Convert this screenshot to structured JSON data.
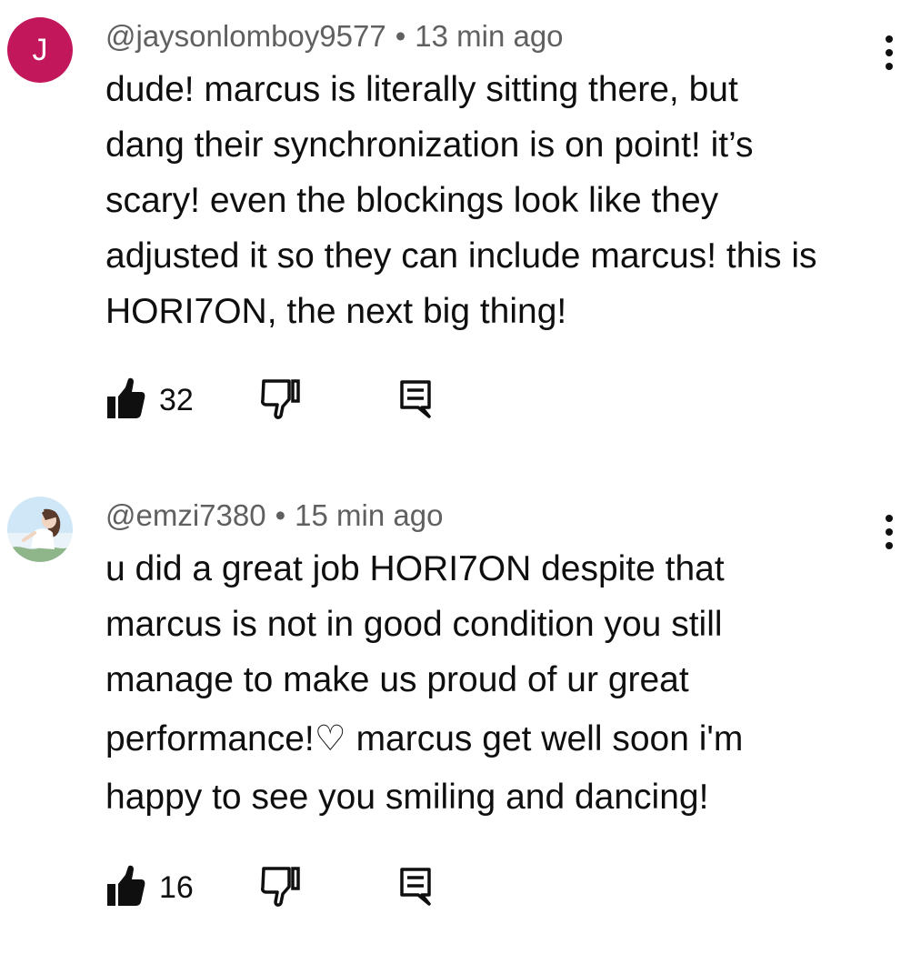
{
  "comments": [
    {
      "avatar_letter": "J",
      "avatar_color": "#c2185b",
      "username": "@jaysonlomboy9577",
      "separator": "•",
      "time": "13 min ago",
      "lines": [
        "dude! marcus is literally sitting there, but",
        "dang their synchronization is on point! it’s",
        "scary! even the blockings look like they",
        "adjusted it so they can include marcus! this is",
        "HORI7ON, the next big thing!"
      ],
      "likes": "32",
      "icons": [
        "thumbs-up-icon",
        "thumbs-down-icon",
        "reply-icon",
        "more-vert-icon"
      ]
    },
    {
      "avatar": "anime-girl-sky-avatar",
      "username": "@emzi7380",
      "separator": "•",
      "time": "15 min ago",
      "lines": [
        "u did a great job HORI7ON despite that",
        "marcus is not in good condition you still",
        "manage to make us proud of ur great",
        "performance!♡ marcus get well soon i'm",
        "happy to see you smiling and dancing!"
      ],
      "likes": "16",
      "icons": [
        "thumbs-up-icon",
        "thumbs-down-icon",
        "reply-icon",
        "more-vert-icon"
      ]
    }
  ]
}
